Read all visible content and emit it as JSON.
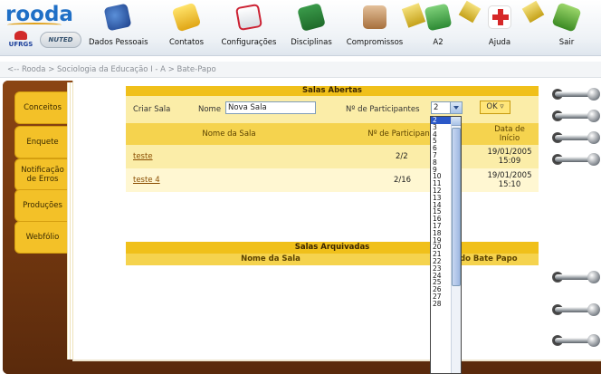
{
  "header": {
    "logo_text": "rooda",
    "ufrgs_text": "UFRGS",
    "nuted_text": "NUTED",
    "nav": [
      {
        "label": "Dados Pessoais",
        "icon": "id-card-icon"
      },
      {
        "label": "Contatos",
        "icon": "contacts-icon"
      },
      {
        "label": "Configurações",
        "icon": "checklist-icon"
      },
      {
        "label": "Disciplinas",
        "icon": "books-icon"
      },
      {
        "label": "Compromissos",
        "icon": "calendar-icon"
      },
      {
        "label": "A2",
        "icon": "a2-icon"
      },
      {
        "label": "Ajuda",
        "icon": "first-aid-icon"
      },
      {
        "label": "Sair",
        "icon": "exit-icon"
      }
    ]
  },
  "breadcrumb": {
    "text": "<-- Rooda > Sociologia da Educação I - A > Bate-Papo"
  },
  "tabs": [
    {
      "label": "Conceitos"
    },
    {
      "label": "Enquete"
    },
    {
      "label": "Notificação de Erros"
    },
    {
      "label": "Produções"
    },
    {
      "label": "Webfólio"
    }
  ],
  "salas_abertas": {
    "title": "Salas Abertas",
    "criar_label": "Criar Sala",
    "nome_label": "Nome",
    "nome_value": "Nova Sala",
    "participantes_label": "Nº de Participantes",
    "participantes_value": "2",
    "ok_label": "OK",
    "columns": [
      "Nome da Sala",
      "Nº de Participantes",
      "Data de Início"
    ],
    "rows": [
      {
        "nome": "teste",
        "participantes": "2/2",
        "data": "19/01/2005",
        "hora": "15:09"
      },
      {
        "nome": "teste 4",
        "participantes": "2/16",
        "data": "19/01/2005",
        "hora": "15:10"
      }
    ]
  },
  "salas_arquivadas": {
    "title": "Salas Arquivadas",
    "columns": [
      "Nome da Sala",
      "Data do Bate Papo"
    ]
  },
  "dropdown_options": [
    "2",
    "3",
    "4",
    "5",
    "6",
    "7",
    "8",
    "9",
    "10",
    "11",
    "12",
    "13",
    "14",
    "15",
    "16",
    "17",
    "18",
    "19",
    "20",
    "21",
    "22",
    "23",
    "24",
    "25",
    "26",
    "27",
    "28"
  ]
}
